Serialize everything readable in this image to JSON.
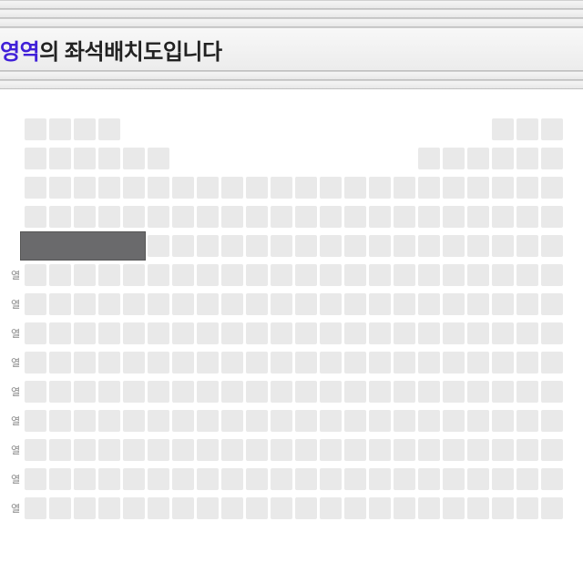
{
  "header": {
    "title_accent": "영역",
    "title_rest": "의 좌석배치도입니다"
  },
  "seatmap": {
    "row_labels": [
      "",
      "",
      "",
      "",
      "",
      "열",
      "열",
      "열",
      "열",
      "열",
      "열",
      "열",
      "열",
      "열"
    ],
    "rows": [
      {
        "pattern": "left_small_gap"
      },
      {
        "pattern": "left_medium"
      },
      {
        "pattern": "full"
      },
      {
        "pattern": "full"
      },
      {
        "pattern": "full_indent"
      },
      {
        "pattern": "full"
      },
      {
        "pattern": "full"
      },
      {
        "pattern": "full"
      },
      {
        "pattern": "full"
      },
      {
        "pattern": "full"
      },
      {
        "pattern": "full"
      },
      {
        "pattern": "full"
      },
      {
        "pattern": "full"
      },
      {
        "pattern": "full"
      }
    ]
  }
}
